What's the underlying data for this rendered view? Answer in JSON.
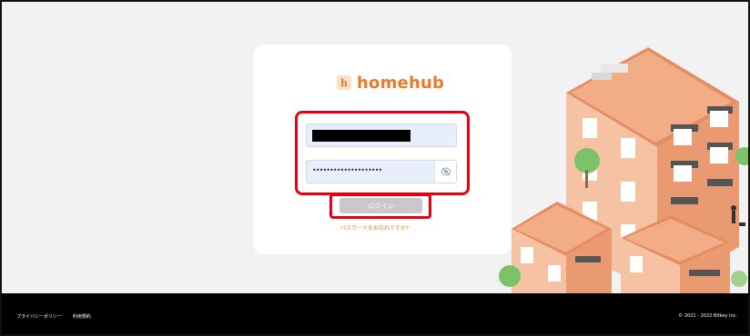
{
  "brand": {
    "name": "homehub",
    "mark": "h"
  },
  "login": {
    "username_value": "",
    "password_value": "••••••••••••••••••••",
    "submit_label": "ログイン",
    "forgot_link": "パスワードをお忘れですか?"
  },
  "footer": {
    "links": [
      "プライバシーポリシー",
      "利用規約"
    ],
    "copyright": "© 2021 - 2022 Bitkey Inc."
  },
  "colors": {
    "brand_orange": "#ea7a2a",
    "highlight_red": "#e60012",
    "input_bg": "#e8effa",
    "button_disabled": "#c9c9c9",
    "footer_bg": "#000000"
  },
  "icons": {
    "password_toggle": "eye-off-icon",
    "logo": "homehub-logo-icon"
  }
}
